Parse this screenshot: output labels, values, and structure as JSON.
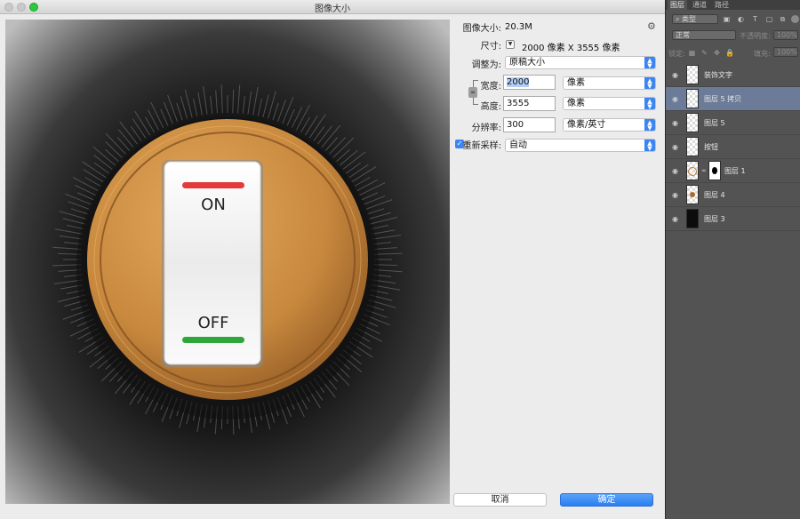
{
  "dialog": {
    "title": "图像大小",
    "image_size_label": "图像大小:",
    "image_size_value": "20.3M",
    "dimensions_label": "尺寸:",
    "dimensions_value": "2000 像素  X  3555 像素",
    "fit_label": "调整为:",
    "fit_value": "原稿大小",
    "width_label": "宽度:",
    "width_value": "2000",
    "width_unit": "像素",
    "height_label": "高度:",
    "height_value": "3555",
    "height_unit": "像素",
    "resolution_label": "分辨率:",
    "resolution_value": "300",
    "resolution_unit": "像素/英寸",
    "resample_label": "重新采样:",
    "resample_checked": true,
    "resample_value": "自动",
    "cancel_button": "取消",
    "ok_button": "确定"
  },
  "preview": {
    "switch_on_label": "ON",
    "switch_off_label": "OFF",
    "colors": {
      "coin": "#c8893e",
      "on_indicator": "#e43a3a",
      "off_indicator": "#2ea63a"
    }
  },
  "layers_panel": {
    "tabs": [
      "图层",
      "通道",
      "路径"
    ],
    "active_tab": "图层",
    "filter_kind": "类型",
    "blend_mode": "正常",
    "opacity_label": "不透明度:",
    "opacity_value": "100%",
    "lock_label": "锁定:",
    "fill_label": "填充:",
    "fill_value": "100%",
    "layers": [
      {
        "name": "装饰文字",
        "selected": false,
        "thumb": "transparent",
        "mask": false
      },
      {
        "name": "图层 5 拷贝",
        "selected": true,
        "thumb": "transparent",
        "mask": false
      },
      {
        "name": "图层 5",
        "selected": false,
        "thumb": "transparent",
        "mask": false
      },
      {
        "name": "按钮",
        "selected": false,
        "thumb": "transparent",
        "mask": false
      },
      {
        "name": "图层 1",
        "selected": false,
        "thumb": "ring",
        "mask": true
      },
      {
        "name": "图层 4",
        "selected": false,
        "thumb": "dot",
        "mask": false
      },
      {
        "name": "图层 3",
        "selected": false,
        "thumb": "dark",
        "mask": false
      }
    ]
  }
}
